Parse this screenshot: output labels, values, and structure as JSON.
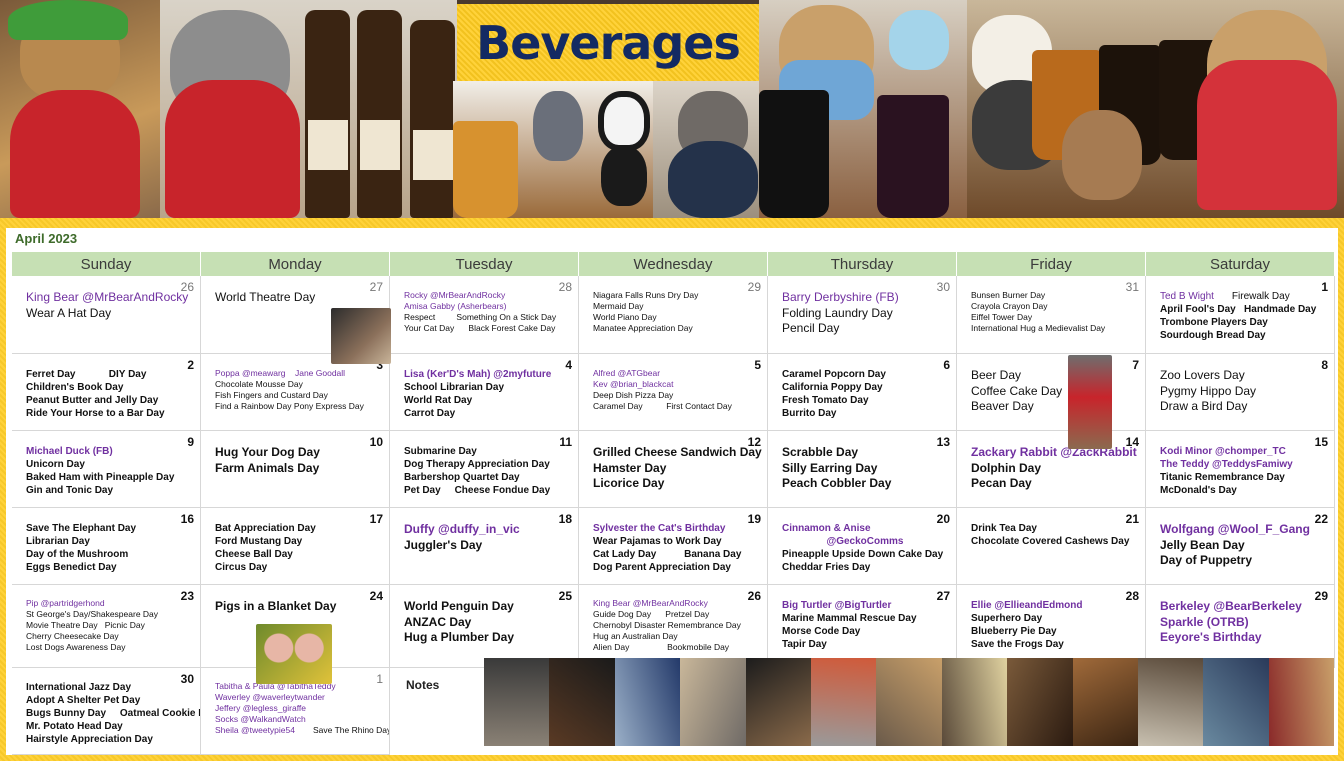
{
  "banner": {
    "title": "Beverages"
  },
  "calendar": {
    "month": "April 2023",
    "weekdays": [
      "Sunday",
      "Monday",
      "Tuesday",
      "Wednesday",
      "Thursday",
      "Friday",
      "Saturday"
    ],
    "weeks": [
      [
        {
          "num": "26",
          "faded": true,
          "lines": [
            [
              "King Bear @MrBearAndRocky",
              "pl"
            ],
            [
              "Wear A Hat Day",
              "l"
            ]
          ]
        },
        {
          "num": "27",
          "faded": true,
          "lines": [
            [
              "World Theatre Day",
              "l"
            ]
          ]
        },
        {
          "num": "28",
          "faded": true,
          "lines": [
            [
              "Rocky @MrBearAndRocky",
              "sp"
            ],
            [
              "Amisa Gabby (Asherbears)",
              "sp"
            ],
            [
              "Respect         Something On a Stick Day",
              "s"
            ],
            [
              "Your Cat Day      Black Forest Cake Day",
              "s"
            ]
          ]
        },
        {
          "num": "29",
          "faded": true,
          "lines": [
            [
              "Niagara Falls Runs Dry Day",
              "s"
            ],
            [
              "Mermaid Day",
              "s"
            ],
            [
              "World Piano Day",
              "s"
            ],
            [
              "Manatee Appreciation Day",
              "s"
            ]
          ]
        },
        {
          "num": "30",
          "faded": true,
          "lines": [
            [
              "Barry Derbyshire (FB)",
              "pl"
            ],
            [
              "Folding Laundry Day",
              "l"
            ],
            [
              "Pencil Day",
              "l"
            ]
          ]
        },
        {
          "num": "31",
          "faded": true,
          "lines": [
            [
              "Bunsen Burner Day",
              "s"
            ],
            [
              "Crayola Crayon Day",
              "s"
            ],
            [
              "Eiffel Tower Day",
              "s"
            ],
            [
              "International Hug a Medievalist Day",
              "s"
            ]
          ]
        },
        {
          "num": "1",
          "lines": [
            [
              "Ted B Wight",
              "mp",
              "Firewalk Day"
            ],
            [
              "April Fool's Day   Handmade Day",
              "m"
            ],
            [
              "Trombone Players Day",
              "m"
            ],
            [
              "Sourdough Bread Day",
              "m"
            ]
          ]
        }
      ],
      [
        {
          "num": "2",
          "lines": [
            [
              "Ferret Day            DIY Day",
              "m"
            ],
            [
              "Children's Book Day",
              "m"
            ],
            [
              "Peanut Butter and Jelly Day",
              "m"
            ],
            [
              "Ride Your Horse to a Bar Day",
              "m"
            ]
          ]
        },
        {
          "num": "3",
          "lines": [
            [
              "Poppa @meawarg    Jane Goodall",
              "sp"
            ],
            [
              "Chocolate Mousse Day",
              "s"
            ],
            [
              "Fish Fingers and Custard Day",
              "s"
            ],
            [
              "Find a Rainbow Day Pony Express Day",
              "s"
            ]
          ]
        },
        {
          "num": "4",
          "lines": [
            [
              "Lisa (Ker'D's Mah) @2myfuture",
              "mpb"
            ],
            [
              "School Librarian Day",
              "m"
            ],
            [
              "World Rat Day",
              "m"
            ],
            [
              "Carrot Day",
              "m"
            ]
          ]
        },
        {
          "num": "5",
          "lines": [
            [
              "Alfred @ATGbear",
              "sp"
            ],
            [
              "Kev @brian_blackcat",
              "sp"
            ],
            [
              "Deep Dish Pizza Day",
              "s"
            ],
            [
              "Caramel Day          First Contact Day",
              "s"
            ]
          ]
        },
        {
          "num": "6",
          "lines": [
            [
              "Caramel Popcorn Day",
              "m"
            ],
            [
              "California Poppy Day",
              "m"
            ],
            [
              "Fresh Tomato Day",
              "m"
            ],
            [
              "Burrito Day",
              "m"
            ]
          ]
        },
        {
          "num": "7",
          "lines": [
            [
              "Beer Day",
              "l"
            ],
            [
              "Coffee Cake Day",
              "l"
            ],
            [
              "Beaver Day",
              "l"
            ]
          ]
        },
        {
          "num": "8",
          "lines": [
            [
              "Zoo Lovers Day",
              "l"
            ],
            [
              "Pygmy Hippo Day",
              "l"
            ],
            [
              "Draw a Bird Day",
              "l"
            ]
          ]
        }
      ],
      [
        {
          "num": "9",
          "lines": [
            [
              "Michael Duck (FB)",
              "mpb"
            ],
            [
              "Unicorn Day",
              "m"
            ],
            [
              "Baked Ham with Pineapple Day",
              "m"
            ],
            [
              "Gin and Tonic Day",
              "m"
            ]
          ]
        },
        {
          "num": "10",
          "lines": [
            [
              "Hug Your Dog Day",
              "lb"
            ],
            [
              "Farm Animals Day",
              "lb"
            ]
          ]
        },
        {
          "num": "11",
          "lines": [
            [
              "Submarine Day",
              "m"
            ],
            [
              "Dog Therapy Appreciation Day",
              "m"
            ],
            [
              "Barbershop Quartet Day",
              "m"
            ],
            [
              "Pet Day     Cheese Fondue Day",
              "m"
            ]
          ]
        },
        {
          "num": "12",
          "lines": [
            [
              "Grilled Cheese Sandwich Day",
              "lb"
            ],
            [
              "Hamster Day",
              "lb"
            ],
            [
              "Licorice Day",
              "lb"
            ]
          ]
        },
        {
          "num": "13",
          "lines": [
            [
              "Scrabble Day",
              "lb"
            ],
            [
              "Silly Earring Day",
              "lb"
            ],
            [
              "Peach Cobbler Day",
              "lb"
            ]
          ]
        },
        {
          "num": "14",
          "lines": [
            [
              "Zackary Rabbit @ZackRabbit",
              "lp"
            ],
            [
              "Dolphin Day",
              "lb"
            ],
            [
              "Pecan Day",
              "lb"
            ]
          ]
        },
        {
          "num": "15",
          "lines": [
            [
              "Kodi Minor @chomper_TC",
              "mpb"
            ],
            [
              "The Teddy @TeddysFamiwy",
              "mpb"
            ],
            [
              "Titanic Remembrance Day",
              "m"
            ],
            [
              "McDonald's Day",
              "m"
            ]
          ]
        }
      ],
      [
        {
          "num": "16",
          "lines": [
            [
              "Save The Elephant Day",
              "m"
            ],
            [
              "Librarian Day",
              "m"
            ],
            [
              "Day of the Mushroom",
              "m"
            ],
            [
              "Eggs Benedict Day",
              "m"
            ]
          ]
        },
        {
          "num": "17",
          "lines": [
            [
              "Bat Appreciation Day",
              "m"
            ],
            [
              "Ford Mustang Day",
              "m"
            ],
            [
              "Cheese Ball Day",
              "m"
            ],
            [
              "Circus Day",
              "m"
            ]
          ]
        },
        {
          "num": "18",
          "lines": [
            [
              "Duffy @duffy_in_vic",
              "lp"
            ],
            [
              "Juggler's Day",
              "lb"
            ]
          ]
        },
        {
          "num": "19",
          "lines": [
            [
              "Sylvester the Cat's Birthday",
              "mpb"
            ],
            [
              "Wear Pajamas to Work Day",
              "m"
            ],
            [
              "Cat Lady Day          Banana Day",
              "m"
            ],
            [
              "Dog Parent Appreciation Day",
              "m"
            ]
          ]
        },
        {
          "num": "20",
          "lines": [
            [
              "Cinnamon & Anise",
              "mpb"
            ],
            [
              "                @GeckoComms",
              "mpb"
            ],
            [
              "Pineapple Upside Down Cake Day",
              "m"
            ],
            [
              "Cheddar Fries Day",
              "m"
            ]
          ]
        },
        {
          "num": "21",
          "lines": [
            [
              "Drink Tea Day",
              "m"
            ],
            [
              "Chocolate Covered Cashews Day",
              "m"
            ]
          ]
        },
        {
          "num": "22",
          "lines": [
            [
              "Wolfgang @Wool_F_Gang",
              "lp"
            ],
            [
              "Jelly Bean Day",
              "lb"
            ],
            [
              "Day of Puppetry",
              "lb"
            ]
          ]
        }
      ],
      [
        {
          "num": "23",
          "lines": [
            [
              "Pip @partridgerhond",
              "sp"
            ],
            [
              "St George's Day/Shakespeare Day",
              "s"
            ],
            [
              "Movie Theatre Day   Picnic Day",
              "s"
            ],
            [
              "Cherry Cheesecake Day",
              "s"
            ],
            [
              "Lost Dogs Awareness Day",
              "s"
            ]
          ]
        },
        {
          "num": "24",
          "lines": [
            [
              "Pigs in a Blanket Day",
              "lb"
            ]
          ]
        },
        {
          "num": "25",
          "lines": [
            [
              "World Penguin Day",
              "lb"
            ],
            [
              "ANZAC Day",
              "lb"
            ],
            [
              "Hug a Plumber Day",
              "lb"
            ]
          ]
        },
        {
          "num": "26",
          "lines": [
            [
              "King Bear @MrBearAndRocky",
              "sp"
            ],
            [
              "Guide Dog Day      Pretzel Day",
              "s"
            ],
            [
              "Chernobyl Disaster Remembrance Day",
              "s"
            ],
            [
              "Hug an Australian Day",
              "s"
            ],
            [
              "Alien Day                Bookmobile Day",
              "s"
            ]
          ]
        },
        {
          "num": "27",
          "lines": [
            [
              "Big Turtler @BigTurtler",
              "mpb"
            ],
            [
              "Marine Mammal Rescue Day",
              "m"
            ],
            [
              "Morse Code Day",
              "m"
            ],
            [
              "Tapir Day",
              "m"
            ]
          ]
        },
        {
          "num": "28",
          "lines": [
            [
              "Ellie @EllieandEdmond",
              "mpb"
            ],
            [
              "Superhero Day",
              "m"
            ],
            [
              "Blueberry Pie Day",
              "m"
            ],
            [
              "Save the Frogs Day",
              "m"
            ]
          ]
        },
        {
          "num": "29",
          "lines": [
            [
              "Berkeley @BearBerkeley",
              "lp"
            ],
            [
              "Sparkle (OTRB)",
              "lp"
            ],
            [
              "Eeyore's Birthday",
              "lp"
            ]
          ]
        }
      ],
      [
        {
          "num": "30",
          "lines": [
            [
              "International Jazz Day",
              "m"
            ],
            [
              "Adopt A Shelter Pet Day",
              "m"
            ],
            [
              "Bugs Bunny Day     Oatmeal Cookie Day",
              "m"
            ],
            [
              "Mr. Potato Head Day",
              "m"
            ],
            [
              "Hairstyle Appreciation Day",
              "m"
            ]
          ]
        },
        {
          "num": "1",
          "faded": true,
          "lines": [
            [
              "Tabitha & Paula @TabithaTeddy",
              "sp"
            ],
            [
              "Waverley @waverleytwander",
              "sp"
            ],
            [
              "Jeffery @legless_giraffe",
              "sp"
            ],
            [
              "Socks @WalkandWatch",
              "sp"
            ],
            [
              "Sheila @tweetypie54",
              "sp",
              "Save The Rhino Day"
            ]
          ]
        },
        {
          "notes": "Notes"
        }
      ]
    ]
  }
}
